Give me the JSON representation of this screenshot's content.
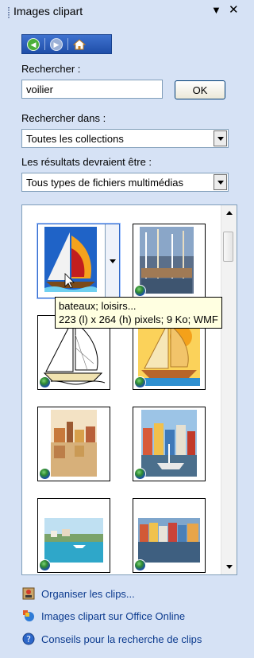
{
  "panel": {
    "title": "Images clipart"
  },
  "search": {
    "label": "Rechercher :",
    "value": "voilier",
    "ok_label": "OK"
  },
  "search_in": {
    "label": "Rechercher dans :",
    "value": "Toutes les collections"
  },
  "result_types": {
    "label": "Les résultats devraient être :",
    "value": "Tous types de fichiers multimédias"
  },
  "tooltip": {
    "line1": "bateaux; loisirs...",
    "line2": "223 (l) x 264 (h) pixels; 9 Ko; WMF"
  },
  "links": {
    "organize": "Organiser les clips...",
    "online": "Images clipart sur Office Online",
    "tips": "Conseils pour la recherche de clips"
  },
  "icons": {
    "back": "back-icon",
    "forward": "forward-icon",
    "home": "home-icon",
    "dropdown": "dropdown-arrow-icon",
    "close": "close-icon",
    "globe": "globe-icon"
  },
  "colors": {
    "panel_bg": "#d6e2f5",
    "nav_bg": "#2f5fbe",
    "link": "#0b3a8e",
    "tooltip_bg": "#ffffe1"
  }
}
